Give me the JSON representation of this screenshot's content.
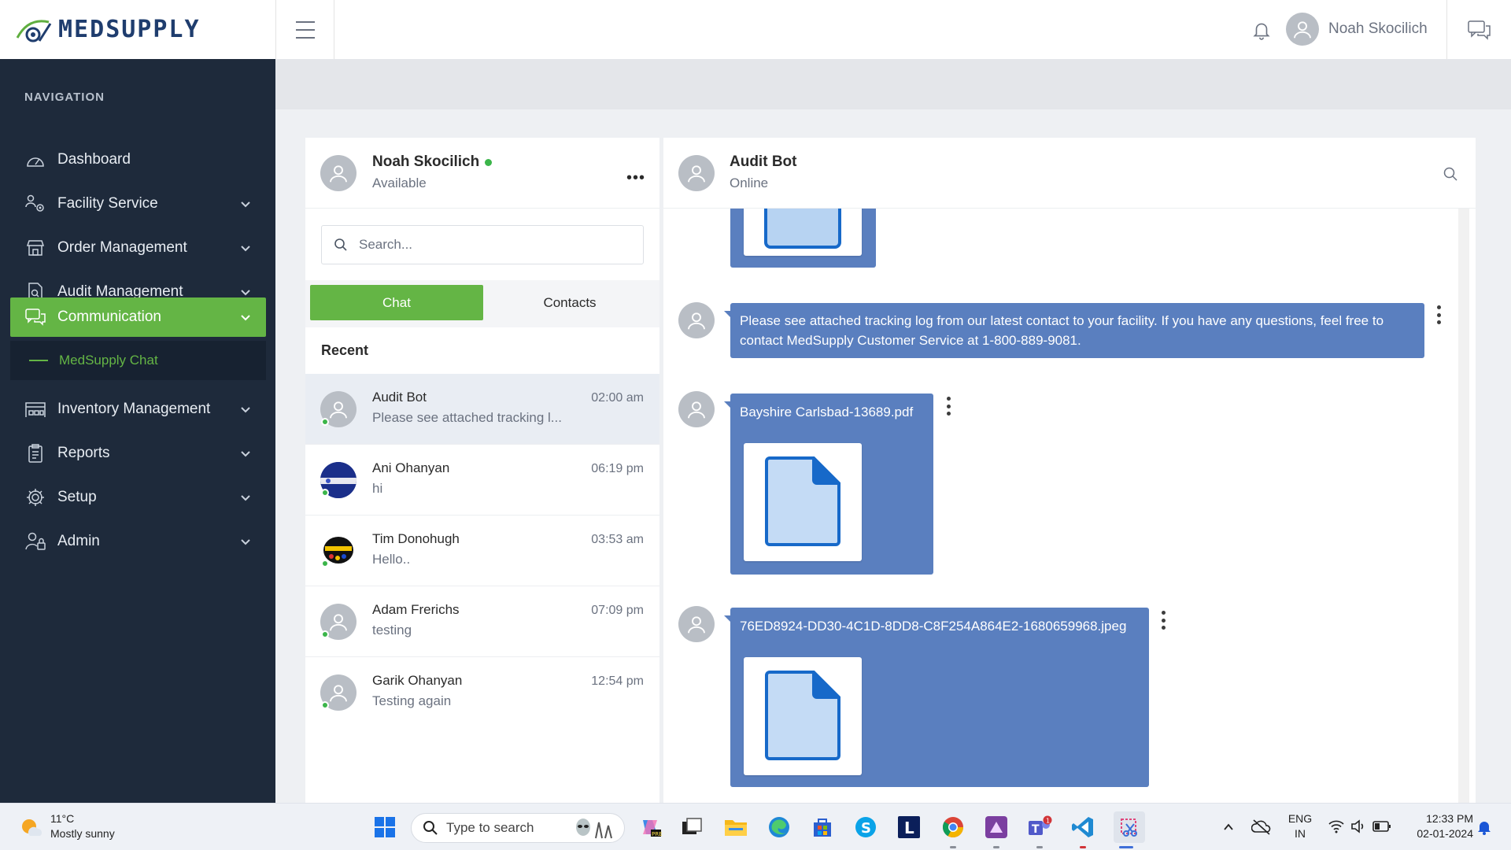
{
  "app": {
    "logo_med": "MED",
    "logo_supply": "SUPPLY"
  },
  "header": {
    "user_name": "Noah Skocilich"
  },
  "sidebar": {
    "heading": "NAVIGATION",
    "items": [
      {
        "label": "Dashboard",
        "icon": "dashboard-icon",
        "has_chevron": false
      },
      {
        "label": "Facility Service",
        "icon": "users-cog-icon",
        "has_chevron": true
      },
      {
        "label": "Order Management",
        "icon": "store-icon",
        "has_chevron": true
      },
      {
        "label": "Audit Management",
        "icon": "document-search-icon",
        "has_chevron": true
      },
      {
        "label": "Communication",
        "icon": "chat-icon",
        "has_chevron": true,
        "active": true
      },
      {
        "label": "Inventory Management",
        "icon": "warehouse-icon",
        "has_chevron": true
      },
      {
        "label": "Reports",
        "icon": "clipboard-icon",
        "has_chevron": true
      },
      {
        "label": "Setup",
        "icon": "gear-icon",
        "has_chevron": true
      },
      {
        "label": "Admin",
        "icon": "user-lock-icon",
        "has_chevron": true
      }
    ],
    "sub_item": "MedSupply Chat"
  },
  "chat_list": {
    "user_name": "Noah Skocilich",
    "user_status": "Available",
    "more_label": "•••",
    "search_placeholder": "Search...",
    "tab_chat": "Chat",
    "tab_contacts": "Contacts",
    "recent_label": "Recent",
    "conversations": [
      {
        "name": "Audit Bot",
        "message": "Please see attached tracking l...",
        "time": "02:00 am",
        "selected": true
      },
      {
        "name": "Ani Ohanyan",
        "message": "hi",
        "time": "06:19 pm"
      },
      {
        "name": "Tim Donohugh",
        "message": "Hello..",
        "time": "03:53 am"
      },
      {
        "name": "Adam Frerichs",
        "message": "testing",
        "time": "07:09 pm"
      },
      {
        "name": "Garik Ohanyan",
        "message": "Testing again",
        "time": "12:54 pm"
      }
    ]
  },
  "conversation": {
    "name": "Audit Bot",
    "status": "Online",
    "messages": [
      {
        "type": "text",
        "text": "Please see attached tracking log from our latest contact to your facility. If you have any questions, feel free to contact MedSupply Customer Service at 1-800-889-9081."
      },
      {
        "type": "file",
        "filename": "Bayshire Carlsbad-13689.pdf"
      },
      {
        "type": "file",
        "filename": "76ED8924-DD30-4C1D-8DD8-C8F254A864E2-1680659968.jpeg"
      }
    ]
  },
  "taskbar": {
    "weather_temp": "11°C",
    "weather_desc": "Mostly sunny",
    "search_placeholder": "Type to search",
    "lang_1": "ENG",
    "lang_2": "IN",
    "time": "12:33 PM",
    "date": "02-01-2024",
    "teams_badge": "1"
  },
  "colors": {
    "sidebar_bg": "#1e2a3b",
    "accent_green": "#64b545",
    "bubble_blue": "#5a7fbf"
  }
}
